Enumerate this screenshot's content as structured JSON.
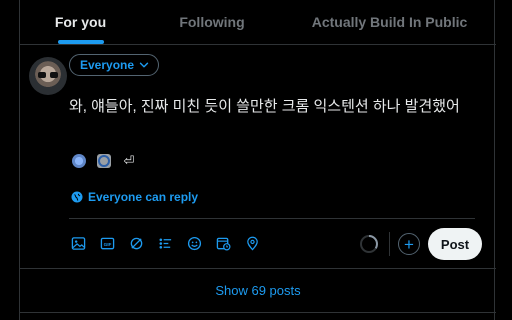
{
  "tabs": [
    {
      "label": "For you",
      "active": true
    },
    {
      "label": "Following",
      "active": false
    },
    {
      "label": "Actually Build In Public",
      "active": false
    }
  ],
  "composer": {
    "audience_label": "Everyone",
    "text": "와, 얘들아, 진짜 미친 듯이 쓸만한 크롬 익스텐션 하나 발견했어",
    "extension_icons": [
      "globe-icon",
      "extension-icon",
      "return-arrow-icon"
    ],
    "return_glyph": "⏎",
    "reply_setting": "Everyone can reply",
    "toolbar_icons": [
      "image-icon",
      "gif-icon",
      "grok-icon",
      "poll-icon",
      "emoji-icon",
      "schedule-icon",
      "location-icon"
    ],
    "add_glyph": "+",
    "post_button": "Post"
  },
  "feed": {
    "show_posts": "Show 69 posts"
  },
  "colors": {
    "accent": "#1d9bf0",
    "background": "#000000",
    "border": "#2f3336",
    "text": "#e7e9ea",
    "muted": "#71767b"
  }
}
